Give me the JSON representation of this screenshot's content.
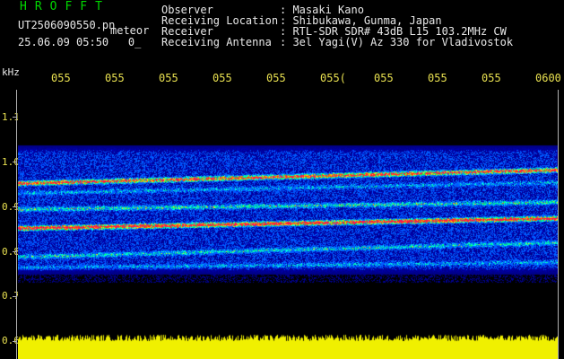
{
  "header": {
    "app_title": "HROFFT",
    "filename": "UT2506090550.pn",
    "station": "meteor",
    "date": "25.06.09",
    "time": "05:50",
    "frame": "0_",
    "info": [
      {
        "label": "Observer",
        "value": ": Masaki Kano"
      },
      {
        "label": "Receiving Location",
        "value": ": Shibukawa, Gunma, Japan"
      },
      {
        "label": "Receiver",
        "value": ": RTL-SDR SDR# 43dB L15 103.2MHz CW"
      },
      {
        "label": "Receiving Antenna",
        "value": ": 3el Yagi(V) Az 330 for Vladivostok"
      }
    ]
  },
  "axis": {
    "unit": "kHz",
    "time_ticks": [
      "055",
      "055",
      "055",
      "055",
      "055",
      "055(",
      "055",
      "055",
      "055",
      "0600"
    ],
    "freq_ticks": [
      "1.1",
      "1.0",
      "0.9",
      "0.8",
      "0.7",
      "0.6"
    ]
  },
  "colors": {
    "background": "#000000",
    "text": "#e8e8e8",
    "axis_text": "#e8e050",
    "title": "#00d800",
    "signal_bar": "#f0f000"
  }
}
